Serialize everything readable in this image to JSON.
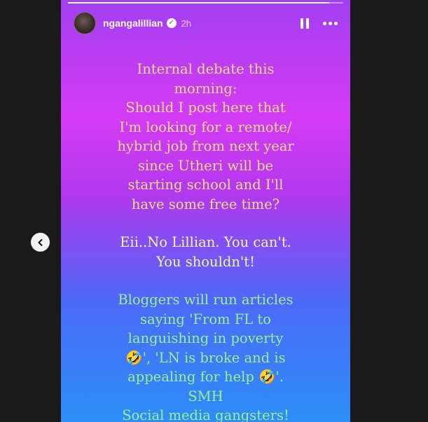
{
  "story": {
    "progress": 0.95,
    "header": {
      "username": "ngangalillian",
      "verified_badge": "✓",
      "time": "2h",
      "pause_icon": "pause-icon",
      "more_icon": "more-options-icon"
    },
    "text": {
      "para1_lines": [
        "Internal debate this",
        "morning:",
        "Should I post here that",
        "I'm looking for a remote/",
        "hybrid job from next year",
        "since Utheri will be",
        "starting school and I'll",
        "have some free time?"
      ],
      "para2_lines": [
        "Eii..No Lillian. You can't.",
        "You shouldn't!"
      ],
      "para3_lines": [
        "Bloggers will run articles",
        "saying 'From FL to",
        "languishing in poverty",
        "🤣', 'LN is broke and is",
        "appealing for help 🤣'.",
        "SMH",
        "Social media gangsters!"
      ]
    }
  },
  "nav": {
    "prev_icon": "chevron-left-icon"
  },
  "colors": {
    "gradient_top": "#a33ff0",
    "gradient_mid": "#d43bf5",
    "gradient_bottom": "#2d8ef7",
    "para1_text": "#f3dc86",
    "para2_text": "#f0f3a2",
    "para3_text": "#9cf08d"
  }
}
